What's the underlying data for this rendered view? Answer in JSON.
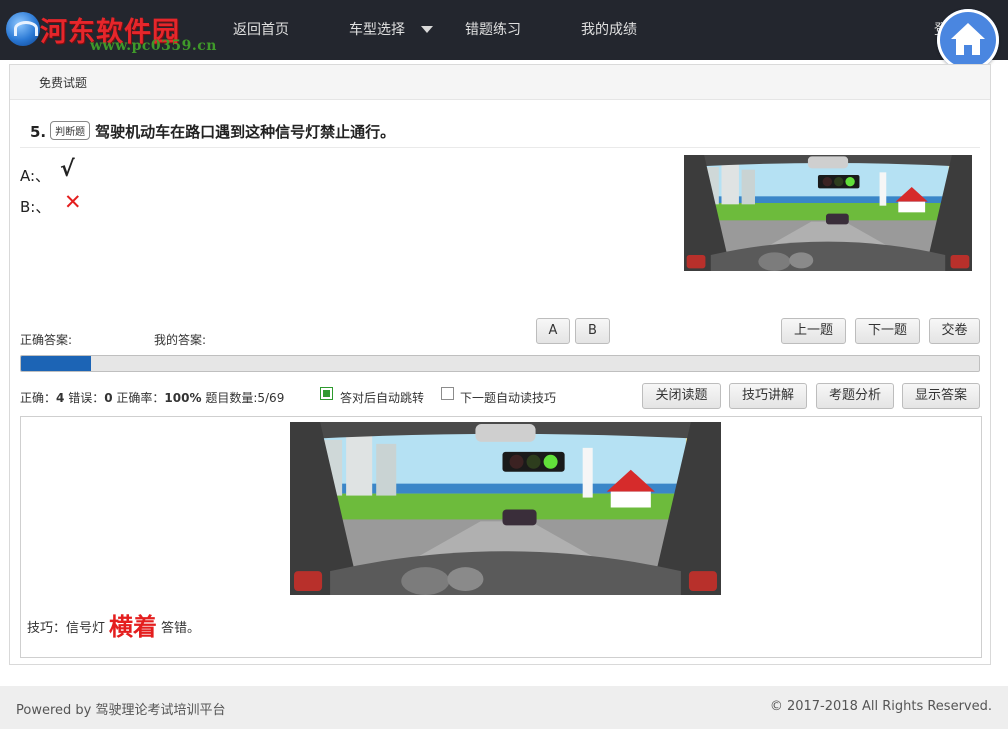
{
  "nav": {
    "logo_text": "河东软件园",
    "logo_url": "www.pc0359.cn",
    "links": [
      "返回首页",
      "车型选择",
      "错题练习",
      "我的成绩"
    ],
    "right_text": "登"
  },
  "panel": {
    "heading": "免费试题"
  },
  "question": {
    "number": "5.",
    "type_tag": "判断题",
    "text": "驾驶机动车在路口遇到这种信号灯禁止通行。",
    "options": [
      {
        "label": "A:、",
        "mark": "√"
      },
      {
        "label": "B:、",
        "mark": "✕"
      }
    ]
  },
  "answer": {
    "correct_label": "正确答案:",
    "mine_label": "我的答案:",
    "choice_buttons": [
      "A",
      "B"
    ],
    "nav_buttons": [
      "上一题",
      "下一题",
      "交卷"
    ]
  },
  "progress": {
    "fraction": 0.073
  },
  "stats": {
    "correct_label": "正确：",
    "correct": "4",
    "wrong_label": "错误：",
    "wrong": "0",
    "rate_label": "正确率：",
    "rate": "100%",
    "count_label": "题目数量:",
    "count": "5/69"
  },
  "toggles": [
    {
      "label": "答对后自动跳转",
      "checked": true
    },
    {
      "label": "下一题自动读技巧",
      "checked": false
    }
  ],
  "tool_buttons": [
    "关闭读题",
    "技巧讲解",
    "考题分析",
    "显示答案"
  ],
  "tip": {
    "prefix": "技巧：信号灯",
    "highlight": "横着",
    "suffix": "答错。"
  },
  "footer": {
    "left": "Powered by 驾驶理论考试培训平台",
    "right": "© 2017-2018 All Rights Reserved."
  },
  "colors": {
    "nav_bg": "#23262e",
    "progress_fill": "#1c64b5",
    "accent_red": "#e41e1e",
    "home_button": "#4a86e0"
  }
}
